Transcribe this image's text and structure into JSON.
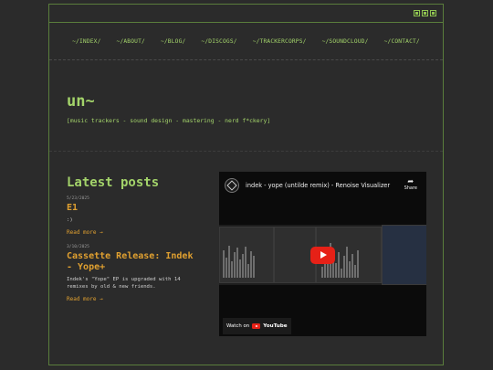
{
  "nav": [
    {
      "label": "~/INDEX/"
    },
    {
      "label": "~/ABOUT/"
    },
    {
      "label": "~/BLOG/"
    },
    {
      "label": "~/DISCOGS/"
    },
    {
      "label": "~/TRACKERCORPS/"
    },
    {
      "label": "~/SOUNDCLOUD/"
    },
    {
      "label": "~/CONTACT/"
    }
  ],
  "site": {
    "title": "un~",
    "tagline": "[music trackers - sound design - mastering - nerd f*ckery]"
  },
  "latest": {
    "heading": "Latest posts",
    "posts": [
      {
        "date": "5/23/2025",
        "title": "E1",
        "excerpt": ":)",
        "read_more": "Read more →"
      },
      {
        "date": "3/10/2025",
        "title": "Cassette Release: Indek - Yope+",
        "excerpt": "Indek's \"Yope\" EP is upgraded with 14 remixes by old & new friends.",
        "read_more": "Read more →"
      }
    ]
  },
  "video": {
    "title": "indek - yope (untilde remix) - Renoise Visualizer",
    "share_label": "Share",
    "watch_on": "Watch on",
    "youtube_label": "YouTube"
  },
  "colors": {
    "accent_green": "#a3d36a",
    "accent_orange": "#e0a030",
    "background": "#2b2b2b",
    "border": "#5a7d3c"
  },
  "icons": {
    "window_controls": [
      "minimize-icon",
      "maximize-icon",
      "close-icon"
    ],
    "share": "share-arrow-icon",
    "play": "play-icon",
    "channel": "channel-logo-icon"
  }
}
